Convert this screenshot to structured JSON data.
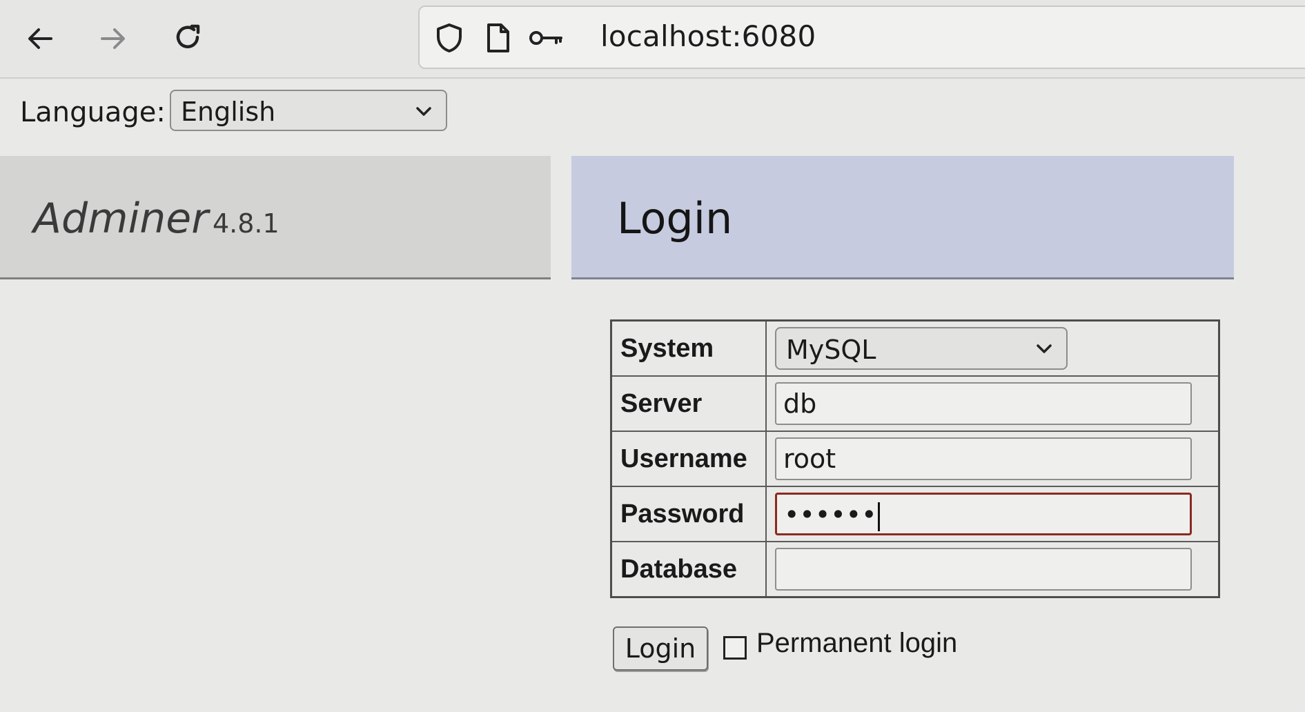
{
  "browser": {
    "url": "localhost:6080",
    "icons": [
      "back-arrow-icon",
      "forward-arrow-icon",
      "reload-icon",
      "shield-icon",
      "page-icon",
      "key-icon"
    ]
  },
  "language": {
    "label": "Language:",
    "selected": "English"
  },
  "brand": {
    "name": "Adminer",
    "version": "4.8.1"
  },
  "page": {
    "heading": "Login"
  },
  "form": {
    "system_label": "System",
    "system_value": "MySQL",
    "server_label": "Server",
    "server_value": "db",
    "username_label": "Username",
    "username_value": "root",
    "password_label": "Password",
    "password_value": "••••••",
    "database_label": "Database",
    "database_value": "",
    "login_button": "Login",
    "permanent_login_label": "Permanent login",
    "permanent_login_checked": false
  },
  "colors": {
    "heading_bg": "#c6cbe0",
    "brand_bg": "#d4d4d2",
    "active_border": "#8a2a1e"
  }
}
